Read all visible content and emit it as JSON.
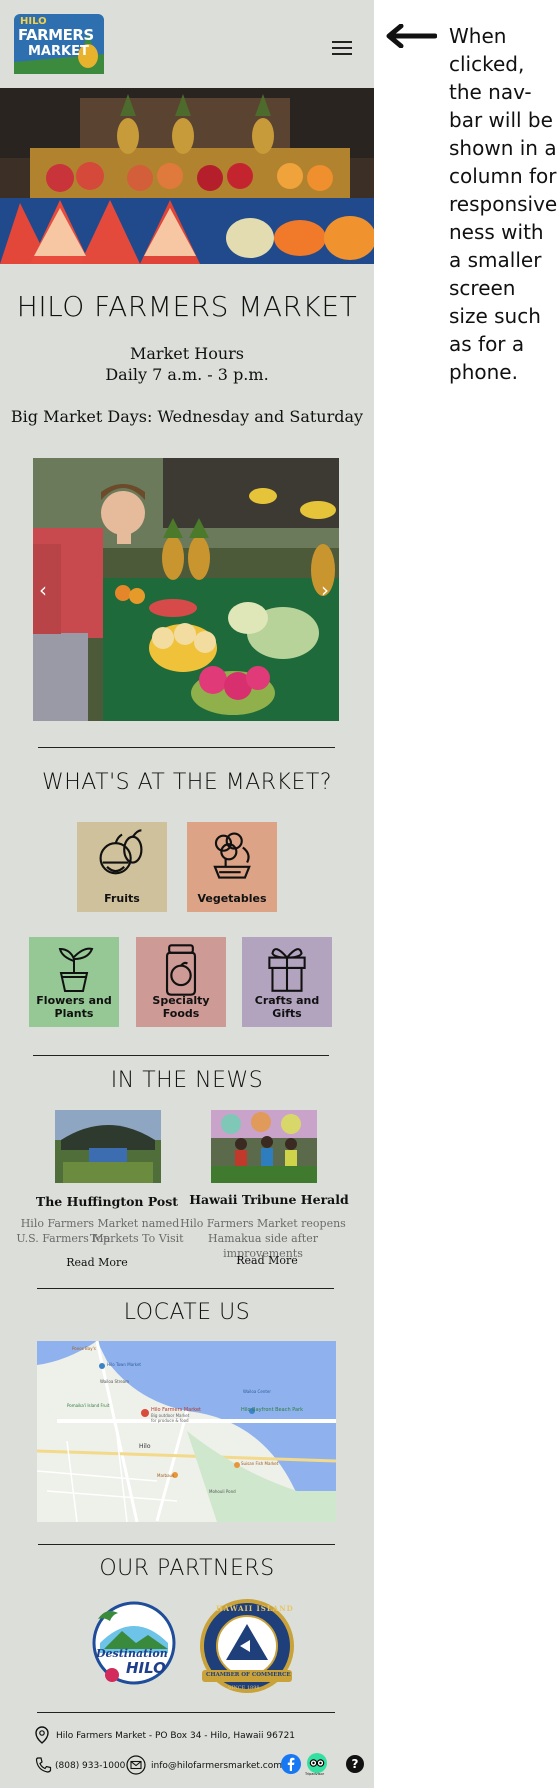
{
  "brand": {
    "logo_top": "HILO",
    "logo_mid": "FARMERS",
    "logo_bottom": "MARKET"
  },
  "hero": {
    "alt": "fruit stand with watermelon, papaya and pineapple"
  },
  "site_title": "HILO FARMERS MARKET",
  "hours": {
    "label": "Market Hours",
    "value": "Daily 7 a.m. - 3 p.m."
  },
  "big_days": "Big Market Days: Wednesday and Saturday",
  "carousel": {
    "prev": "‹",
    "next": "›"
  },
  "market": {
    "title": "WHAT'S AT THE MARKET?",
    "categories": [
      {
        "label": "Fruits",
        "color": "#cfc19b",
        "icon": "fruit-icon"
      },
      {
        "label": "Vegetables",
        "color": "#dca386",
        "icon": "vegetable-icon"
      },
      {
        "label": "Flowers and Plants",
        "color": "#95c894",
        "icon": "plant-icon"
      },
      {
        "label": "Specialty Foods",
        "color": "#cd9a96",
        "icon": "jar-icon"
      },
      {
        "label": "Crafts and Gifts",
        "color": "#b2a3bf",
        "icon": "gift-icon"
      }
    ]
  },
  "news": {
    "title": "IN THE NEWS",
    "items": [
      {
        "source": "The Huffington Post",
        "text1": "Hilo Farmers Market named Top",
        "text2": "U.S. Farmers Markets To Visit",
        "link": "Read More"
      },
      {
        "source": "Hawaii Tribune Herald",
        "text1": "Hilo Farmers Market reopens",
        "text2": "Hamakua side after improvements",
        "link": "Read More"
      }
    ]
  },
  "locate": {
    "title": "LOCATE US",
    "map_labels": {
      "poi_main": "Hilo Farmers Market",
      "poi_sub1": "Big outdoor Market",
      "poi_sub2": "for produce & food",
      "town": "Hilo",
      "road": "Hilo Bayfront Beach Park",
      "poi_a": "Ponos Bay's",
      "poi_b": "Hilo Town Market",
      "poi_c": "Pomaika'i Island Fruit",
      "poi_d": "Wailoa Stream",
      "poi_e": "Wailoa Center",
      "poi_f": "Suisan Fish Market",
      "poi_g": "Marbaus",
      "poi_h": "Mohouli Pond",
      "poi_i": "Hilo Bay"
    }
  },
  "partners": {
    "title": "OUR PARTNERS",
    "destination": {
      "line1": "Destination",
      "line2": "HILO"
    },
    "chamber": {
      "top": "HAWAII ISLAND",
      "bottom": "CHAMBER OF COMMERCE",
      "since": "SINCE 1898"
    }
  },
  "footer": {
    "address": "Hilo Farmers Market - PO Box 34 - Hilo, Hawaii 96721",
    "phone": "(808) 933-1000",
    "email": "info@hilofarmersmarket.com",
    "tripadvisor": "Tripadvisor",
    "help": "?"
  },
  "annotation": {
    "text": "When clicked, the nav-bar will be shown in a column for responsive ness with a smaller screen size such as for a phone."
  }
}
